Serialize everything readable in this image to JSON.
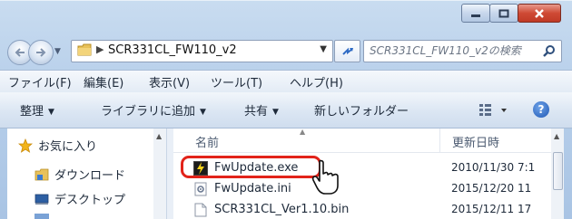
{
  "address": {
    "path": "SCR331CL_FW110_v2",
    "search_placeholder": "SCR331CL_FW110_v2の検索"
  },
  "menu": [
    "ファイル(F)",
    "編集(E)",
    "表示(V)",
    "ツール(T)",
    "ヘルプ(H)"
  ],
  "commands": {
    "organize": "整理",
    "add_to_library": "ライブラリに追加",
    "share": "共有",
    "new_folder": "新しいフォルダー"
  },
  "nav": {
    "favorites": "お気に入り",
    "downloads": "ダウンロード",
    "desktop": "デスクトップ"
  },
  "columns": {
    "name": "名前",
    "modified": "更新日時"
  },
  "files": [
    {
      "name": "FwUpdate.exe",
      "modified": "2010/11/30 7:1"
    },
    {
      "name": "FwUpdate.ini",
      "modified": "2015/12/20 11"
    },
    {
      "name": "SCR331CL_Ver1.10.bin",
      "modified": "2015/12/11 17"
    }
  ],
  "colors": {
    "highlight": "#e2231a",
    "window_frame": "#b7cfea"
  }
}
